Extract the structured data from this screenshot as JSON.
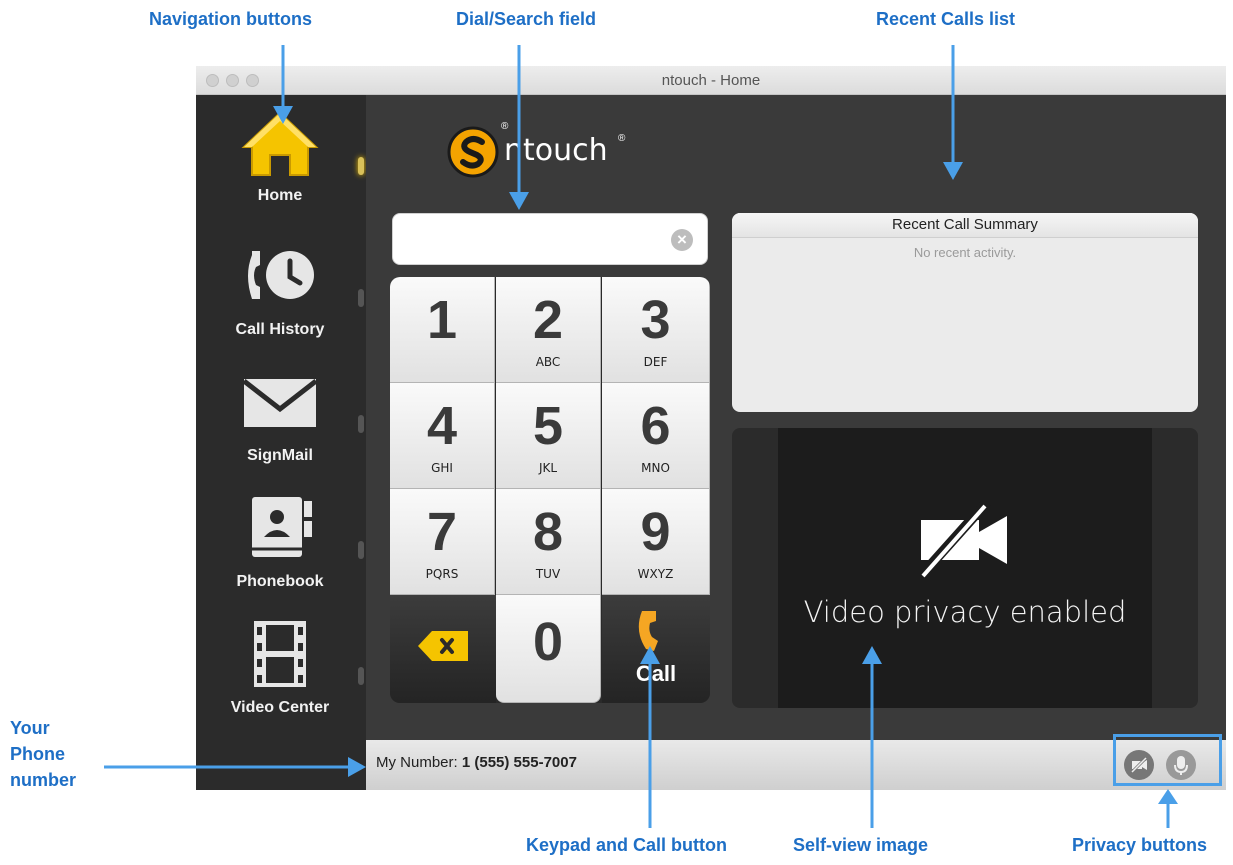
{
  "annotations": {
    "navigation_buttons": "Navigation buttons",
    "dial_search_field": "Dial/Search field",
    "recent_calls_list": "Recent Calls list",
    "your_phone_number": [
      "Your",
      "Phone",
      "number"
    ],
    "keypad_and_call": "Keypad and Call button",
    "self_view": "Self-view image",
    "privacy_buttons": "Privacy buttons"
  },
  "window": {
    "title": "ntouch - Home"
  },
  "logo": {
    "text": "ntouch",
    "registered": "®"
  },
  "sidebar": {
    "items": [
      {
        "label": "Home",
        "icon": "home-icon",
        "active": true
      },
      {
        "label": "Call History",
        "icon": "call-history-icon"
      },
      {
        "label": "SignMail",
        "icon": "signmail-envelope-icon"
      },
      {
        "label": "Phonebook",
        "icon": "phonebook-icon"
      },
      {
        "label": "Video Center",
        "icon": "film-strip-icon"
      }
    ]
  },
  "search": {
    "value": "",
    "placeholder": "",
    "clear_icon": "clear-x-icon"
  },
  "keypad": {
    "keys": [
      {
        "digit": "1",
        "letters": ""
      },
      {
        "digit": "2",
        "letters": "ABC"
      },
      {
        "digit": "3",
        "letters": "DEF"
      },
      {
        "digit": "4",
        "letters": "GHI"
      },
      {
        "digit": "5",
        "letters": "JKL"
      },
      {
        "digit": "6",
        "letters": "MNO"
      },
      {
        "digit": "7",
        "letters": "PQRS"
      },
      {
        "digit": "8",
        "letters": "TUV"
      },
      {
        "digit": "9",
        "letters": "WXYZ"
      },
      {
        "digit": "0",
        "letters": ""
      }
    ],
    "call_label": "Call",
    "backspace_icon": "backspace-icon",
    "call_icon": "phone-handset-icon"
  },
  "recent_calls": {
    "title": "Recent Call Summary",
    "empty_text": "No recent activity."
  },
  "video": {
    "message": "Video privacy enabled",
    "icon": "video-off-icon"
  },
  "status_bar": {
    "my_number_label": "My Number:",
    "my_number_value": "1 (555) 555-7007"
  },
  "privacy": {
    "video_privacy_icon": "video-privacy-icon",
    "audio_privacy_icon": "microphone-privacy-icon"
  },
  "colors": {
    "annotation_blue": "#1e6fc6",
    "arrow_blue": "#4a9fe8",
    "home_icon_yellow": "#f5c400",
    "logo_orange": "#f4a300",
    "backspace_yellow": "#f5c400",
    "call_orange": "#f5a623"
  }
}
